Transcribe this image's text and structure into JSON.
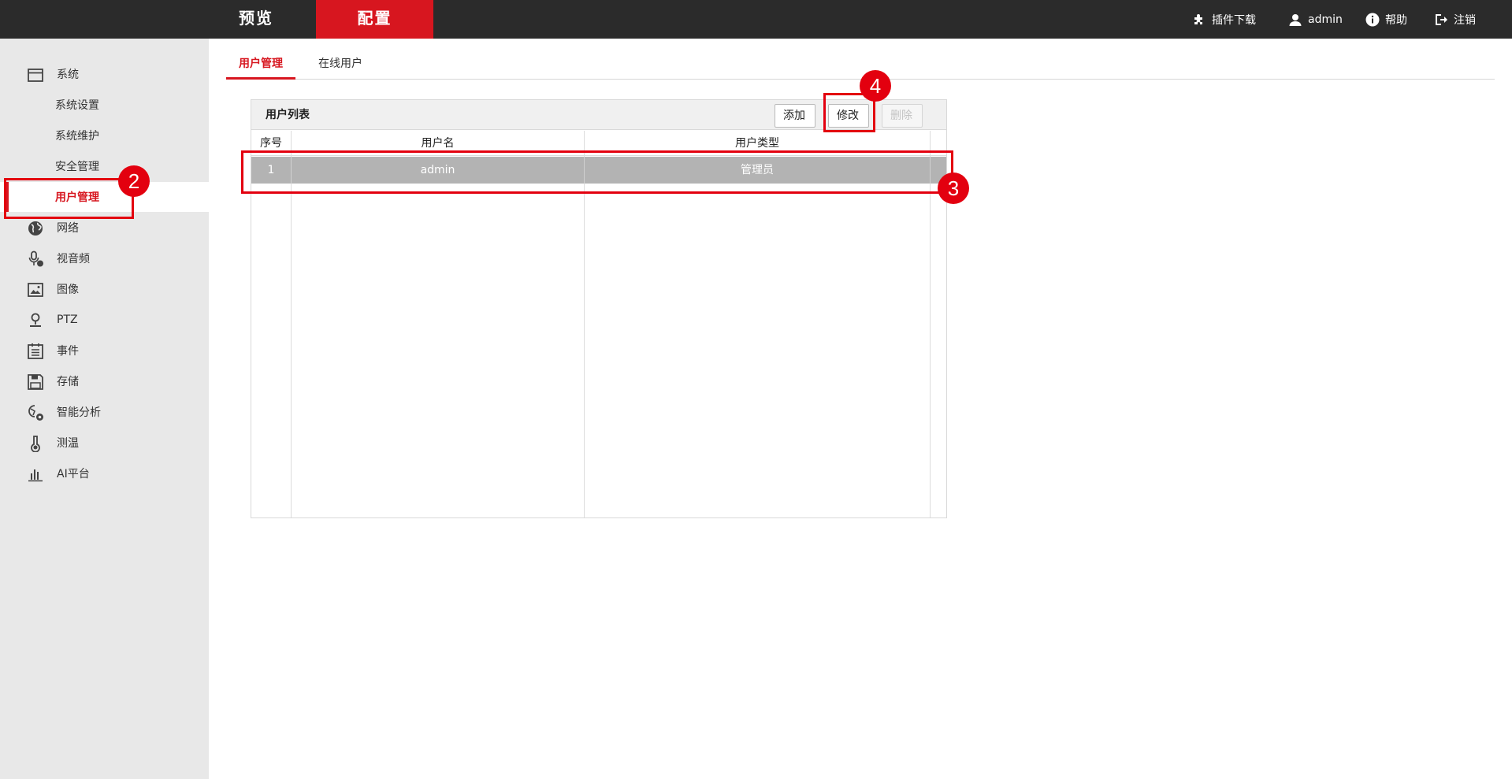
{
  "topbar": {
    "tabs": [
      {
        "label": "预览",
        "active": false
      },
      {
        "label": "配置",
        "active": true
      }
    ],
    "right_links": [
      {
        "label": "插件下载",
        "icon": "puzzle-icon"
      },
      {
        "label": "admin",
        "icon": "user-icon"
      },
      {
        "label": "帮助",
        "icon": "info-icon"
      },
      {
        "label": "注销",
        "icon": "logout-icon"
      }
    ]
  },
  "sidebar": {
    "items": [
      {
        "label": "系统",
        "icon": "window-icon",
        "type": "group"
      },
      {
        "label": "系统设置",
        "type": "sub"
      },
      {
        "label": "系统维护",
        "type": "sub"
      },
      {
        "label": "安全管理",
        "type": "sub"
      },
      {
        "label": "用户管理",
        "type": "sub",
        "active": true
      },
      {
        "label": "网络",
        "icon": "globe-icon",
        "type": "group"
      },
      {
        "label": "视音频",
        "icon": "microphone-icon",
        "type": "group"
      },
      {
        "label": "图像",
        "icon": "image-icon",
        "type": "group"
      },
      {
        "label": "PTZ",
        "icon": "ptz-icon",
        "type": "group"
      },
      {
        "label": "事件",
        "icon": "calendar-icon",
        "type": "group"
      },
      {
        "label": "存储",
        "icon": "floppy-icon",
        "type": "group"
      },
      {
        "label": "智能分析",
        "icon": "smart-analysis-icon",
        "type": "group"
      },
      {
        "label": "测温",
        "icon": "thermometer-icon",
        "type": "group"
      },
      {
        "label": "AI平台",
        "icon": "bar-chart-icon",
        "type": "group"
      }
    ]
  },
  "subtabs": [
    {
      "label": "用户管理",
      "active": true
    },
    {
      "label": "在线用户",
      "active": false
    }
  ],
  "user_list": {
    "title": "用户列表",
    "buttons": {
      "add": "添加",
      "edit": "修改",
      "delete": "删除"
    },
    "columns": [
      "序号",
      "用户名",
      "用户类型"
    ],
    "rows": [
      {
        "index": "1",
        "username": "admin",
        "type": "管理员",
        "selected": true
      }
    ]
  },
  "annotations": [
    "2",
    "3",
    "4"
  ],
  "colors": {
    "accent": "#d7161f",
    "topbar": "#2b2b2b",
    "sidebar": "#e8e8e8",
    "selected_row": "#b3b3b3",
    "annotation": "#e3000f"
  }
}
